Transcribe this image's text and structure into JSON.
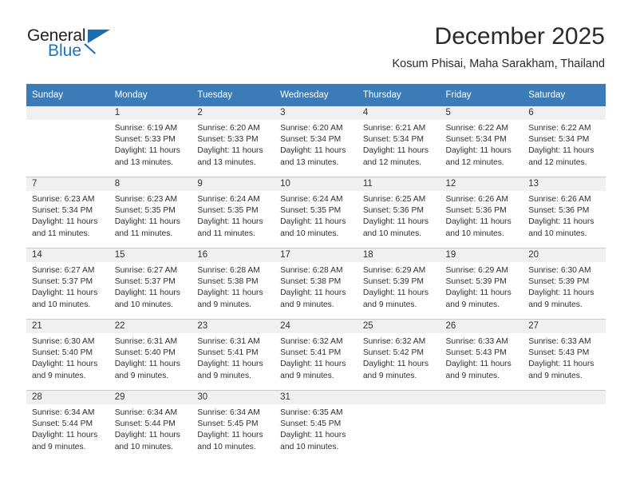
{
  "brand": {
    "name_part1": "General",
    "name_part2": "Blue",
    "triangle_color": "#1b6cb0"
  },
  "header": {
    "title": "December 2025",
    "subtitle": "Kosum Phisai, Maha Sarakham, Thailand"
  },
  "theme": {
    "header_bg": "#3b7cb8",
    "daynum_bg": "#f0f0f0",
    "grid_line": "#c8c8c8",
    "text": "#2f2f2f"
  },
  "weekdays": [
    "Sunday",
    "Monday",
    "Tuesday",
    "Wednesday",
    "Thursday",
    "Friday",
    "Saturday"
  ],
  "weeks": [
    [
      {
        "day": "",
        "sunrise": "",
        "sunset": "",
        "daylight": "",
        "blank": true
      },
      {
        "day": "1",
        "sunrise": "Sunrise: 6:19 AM",
        "sunset": "Sunset: 5:33 PM",
        "daylight": "Daylight: 11 hours and 13 minutes."
      },
      {
        "day": "2",
        "sunrise": "Sunrise: 6:20 AM",
        "sunset": "Sunset: 5:33 PM",
        "daylight": "Daylight: 11 hours and 13 minutes."
      },
      {
        "day": "3",
        "sunrise": "Sunrise: 6:20 AM",
        "sunset": "Sunset: 5:34 PM",
        "daylight": "Daylight: 11 hours and 13 minutes."
      },
      {
        "day": "4",
        "sunrise": "Sunrise: 6:21 AM",
        "sunset": "Sunset: 5:34 PM",
        "daylight": "Daylight: 11 hours and 12 minutes."
      },
      {
        "day": "5",
        "sunrise": "Sunrise: 6:22 AM",
        "sunset": "Sunset: 5:34 PM",
        "daylight": "Daylight: 11 hours and 12 minutes."
      },
      {
        "day": "6",
        "sunrise": "Sunrise: 6:22 AM",
        "sunset": "Sunset: 5:34 PM",
        "daylight": "Daylight: 11 hours and 12 minutes."
      }
    ],
    [
      {
        "day": "7",
        "sunrise": "Sunrise: 6:23 AM",
        "sunset": "Sunset: 5:34 PM",
        "daylight": "Daylight: 11 hours and 11 minutes."
      },
      {
        "day": "8",
        "sunrise": "Sunrise: 6:23 AM",
        "sunset": "Sunset: 5:35 PM",
        "daylight": "Daylight: 11 hours and 11 minutes."
      },
      {
        "day": "9",
        "sunrise": "Sunrise: 6:24 AM",
        "sunset": "Sunset: 5:35 PM",
        "daylight": "Daylight: 11 hours and 11 minutes."
      },
      {
        "day": "10",
        "sunrise": "Sunrise: 6:24 AM",
        "sunset": "Sunset: 5:35 PM",
        "daylight": "Daylight: 11 hours and 10 minutes."
      },
      {
        "day": "11",
        "sunrise": "Sunrise: 6:25 AM",
        "sunset": "Sunset: 5:36 PM",
        "daylight": "Daylight: 11 hours and 10 minutes."
      },
      {
        "day": "12",
        "sunrise": "Sunrise: 6:26 AM",
        "sunset": "Sunset: 5:36 PM",
        "daylight": "Daylight: 11 hours and 10 minutes."
      },
      {
        "day": "13",
        "sunrise": "Sunrise: 6:26 AM",
        "sunset": "Sunset: 5:36 PM",
        "daylight": "Daylight: 11 hours and 10 minutes."
      }
    ],
    [
      {
        "day": "14",
        "sunrise": "Sunrise: 6:27 AM",
        "sunset": "Sunset: 5:37 PM",
        "daylight": "Daylight: 11 hours and 10 minutes."
      },
      {
        "day": "15",
        "sunrise": "Sunrise: 6:27 AM",
        "sunset": "Sunset: 5:37 PM",
        "daylight": "Daylight: 11 hours and 10 minutes."
      },
      {
        "day": "16",
        "sunrise": "Sunrise: 6:28 AM",
        "sunset": "Sunset: 5:38 PM",
        "daylight": "Daylight: 11 hours and 9 minutes."
      },
      {
        "day": "17",
        "sunrise": "Sunrise: 6:28 AM",
        "sunset": "Sunset: 5:38 PM",
        "daylight": "Daylight: 11 hours and 9 minutes."
      },
      {
        "day": "18",
        "sunrise": "Sunrise: 6:29 AM",
        "sunset": "Sunset: 5:39 PM",
        "daylight": "Daylight: 11 hours and 9 minutes."
      },
      {
        "day": "19",
        "sunrise": "Sunrise: 6:29 AM",
        "sunset": "Sunset: 5:39 PM",
        "daylight": "Daylight: 11 hours and 9 minutes."
      },
      {
        "day": "20",
        "sunrise": "Sunrise: 6:30 AM",
        "sunset": "Sunset: 5:39 PM",
        "daylight": "Daylight: 11 hours and 9 minutes."
      }
    ],
    [
      {
        "day": "21",
        "sunrise": "Sunrise: 6:30 AM",
        "sunset": "Sunset: 5:40 PM",
        "daylight": "Daylight: 11 hours and 9 minutes."
      },
      {
        "day": "22",
        "sunrise": "Sunrise: 6:31 AM",
        "sunset": "Sunset: 5:40 PM",
        "daylight": "Daylight: 11 hours and 9 minutes."
      },
      {
        "day": "23",
        "sunrise": "Sunrise: 6:31 AM",
        "sunset": "Sunset: 5:41 PM",
        "daylight": "Daylight: 11 hours and 9 minutes."
      },
      {
        "day": "24",
        "sunrise": "Sunrise: 6:32 AM",
        "sunset": "Sunset: 5:41 PM",
        "daylight": "Daylight: 11 hours and 9 minutes."
      },
      {
        "day": "25",
        "sunrise": "Sunrise: 6:32 AM",
        "sunset": "Sunset: 5:42 PM",
        "daylight": "Daylight: 11 hours and 9 minutes."
      },
      {
        "day": "26",
        "sunrise": "Sunrise: 6:33 AM",
        "sunset": "Sunset: 5:43 PM",
        "daylight": "Daylight: 11 hours and 9 minutes."
      },
      {
        "day": "27",
        "sunrise": "Sunrise: 6:33 AM",
        "sunset": "Sunset: 5:43 PM",
        "daylight": "Daylight: 11 hours and 9 minutes."
      }
    ],
    [
      {
        "day": "28",
        "sunrise": "Sunrise: 6:34 AM",
        "sunset": "Sunset: 5:44 PM",
        "daylight": "Daylight: 11 hours and 9 minutes."
      },
      {
        "day": "29",
        "sunrise": "Sunrise: 6:34 AM",
        "sunset": "Sunset: 5:44 PM",
        "daylight": "Daylight: 11 hours and 10 minutes."
      },
      {
        "day": "30",
        "sunrise": "Sunrise: 6:34 AM",
        "sunset": "Sunset: 5:45 PM",
        "daylight": "Daylight: 11 hours and 10 minutes."
      },
      {
        "day": "31",
        "sunrise": "Sunrise: 6:35 AM",
        "sunset": "Sunset: 5:45 PM",
        "daylight": "Daylight: 11 hours and 10 minutes."
      },
      {
        "day": "",
        "sunrise": "",
        "sunset": "",
        "daylight": "",
        "blank": true
      },
      {
        "day": "",
        "sunrise": "",
        "sunset": "",
        "daylight": "",
        "blank": true
      },
      {
        "day": "",
        "sunrise": "",
        "sunset": "",
        "daylight": "",
        "blank": true
      }
    ]
  ]
}
